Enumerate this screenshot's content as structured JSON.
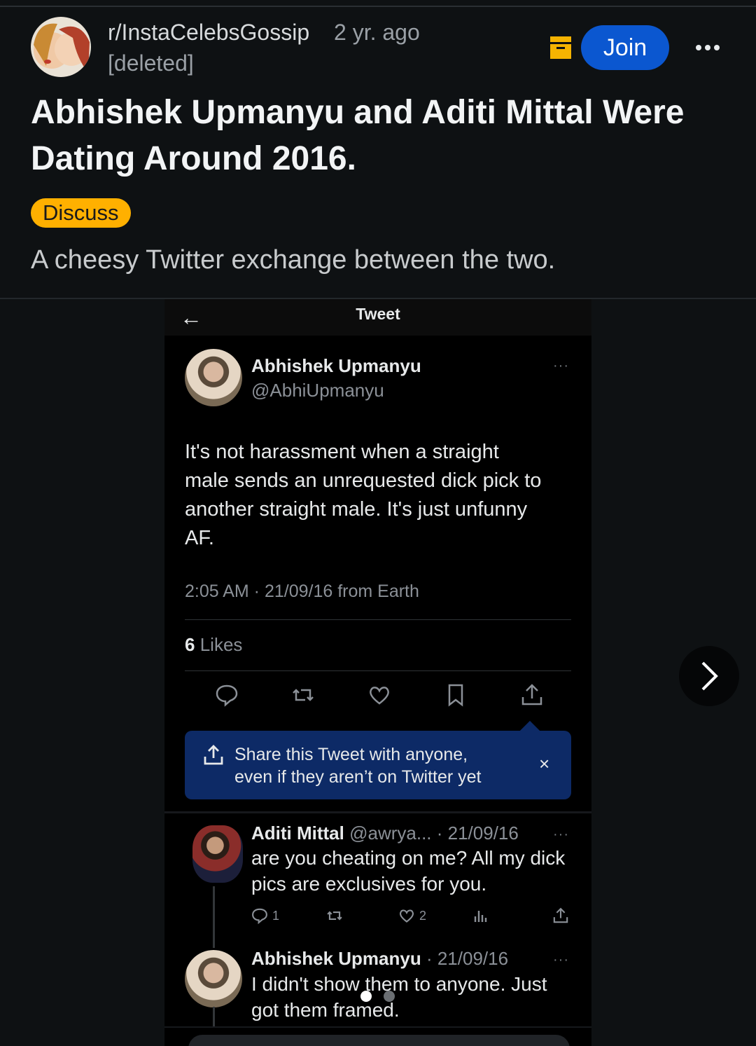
{
  "post": {
    "subreddit": "r/InstaCelebsGossip",
    "age": "2 yr. ago",
    "author": "[deleted]",
    "join_label": "Join",
    "title_line1": "Abhishek Upmanyu and Aditi Mittal Were",
    "title_line2": "Dating Around 2016.",
    "flair": "Discuss",
    "body": "A cheesy Twitter exchange between the two."
  },
  "tweet": {
    "header_title": "Tweet",
    "back_icon": "←",
    "author_name": "Abhishek Upmanyu",
    "author_handle": "@AbhiUpmanyu",
    "more": "···",
    "text_lines": [
      "It's not harassment when a straight",
      "male sends an unrequested dick pick to",
      "another straight male. It's just unfunny",
      "AF."
    ],
    "meta": "2:05 AM · 21/09/16 from Earth",
    "likes_count": "6",
    "likes_label": "Likes",
    "share_line1": "Share this Tweet with anyone,",
    "share_line2": "even if they aren’t on Twitter yet",
    "share_close": "×"
  },
  "reply1": {
    "name": "Aditi Mittal",
    "handle_date": "@awrya... · 21/09/16",
    "more": "···",
    "text_lines": [
      "are you cheating on me? All my dick",
      "pics are exclusives for you."
    ],
    "reply_count": "1",
    "like_count": "2"
  },
  "reply2": {
    "name": "Abhishek Upmanyu",
    "date": "· 21/09/16",
    "more": "···",
    "text_lines": [
      "I didn't show them to anyone. Just",
      "got them framed."
    ]
  },
  "colors": {
    "background": "#0e1113",
    "join_button": "#0b57d0",
    "flair": "#ffb000",
    "share_card": "#0d2a66"
  },
  "icons": [
    "archive-icon",
    "more-icon",
    "back-arrow-icon",
    "reply-icon",
    "retweet-icon",
    "like-icon",
    "bookmark-icon",
    "share-icon",
    "close-icon",
    "views-icon",
    "chevron-right-icon"
  ],
  "carousel": {
    "total_slides": 2,
    "active_slide": 1
  }
}
